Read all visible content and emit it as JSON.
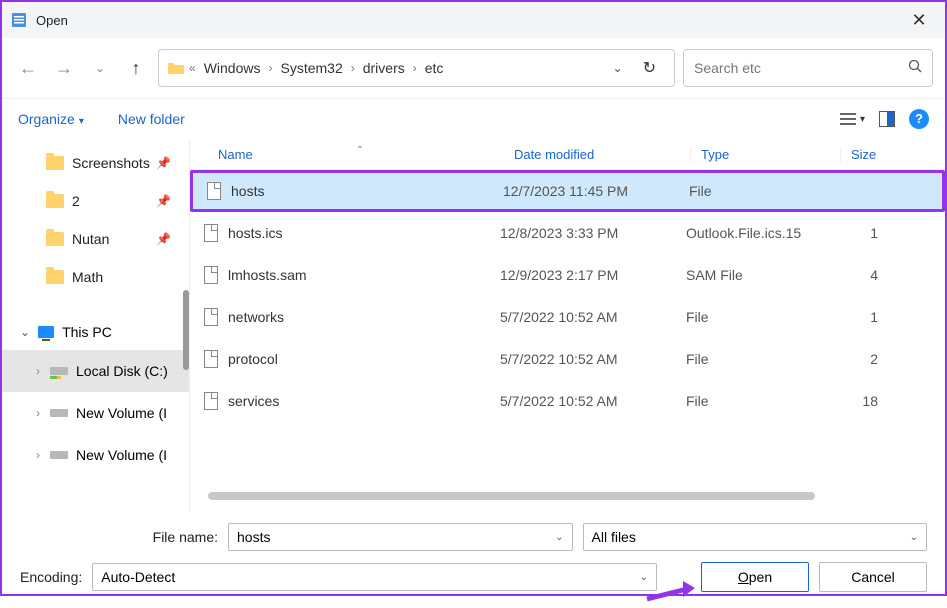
{
  "window": {
    "title": "Open"
  },
  "breadcrumbs": [
    "Windows",
    "System32",
    "drivers",
    "etc"
  ],
  "search": {
    "placeholder": "Search etc"
  },
  "toolbar": {
    "organize": "Organize",
    "new_folder": "New folder"
  },
  "sidebar": {
    "quick": [
      {
        "label": "Screenshots",
        "pinned": true
      },
      {
        "label": "2",
        "pinned": true
      },
      {
        "label": "Nutan",
        "pinned": true
      },
      {
        "label": "Math",
        "pinned": false
      }
    ],
    "this_pc": "This PC",
    "drives": [
      {
        "label": "Local Disk (C:)",
        "selected": true
      },
      {
        "label": "New Volume (I",
        "selected": false
      },
      {
        "label": "New Volume (I",
        "selected": false
      }
    ]
  },
  "columns": {
    "name": "Name",
    "date": "Date modified",
    "type": "Type",
    "size": "Size"
  },
  "files": [
    {
      "name": "hosts",
      "date": "12/7/2023 11:45 PM",
      "type": "File",
      "size": "",
      "highlighted": true
    },
    {
      "name": "hosts.ics",
      "date": "12/8/2023 3:33 PM",
      "type": "Outlook.File.ics.15",
      "size": "1"
    },
    {
      "name": "lmhosts.sam",
      "date": "12/9/2023 2:17 PM",
      "type": "SAM File",
      "size": "4"
    },
    {
      "name": "networks",
      "date": "5/7/2022 10:52 AM",
      "type": "File",
      "size": "1"
    },
    {
      "name": "protocol",
      "date": "5/7/2022 10:52 AM",
      "type": "File",
      "size": "2"
    },
    {
      "name": "services",
      "date": "5/7/2022 10:52 AM",
      "type": "File",
      "size": "18"
    }
  ],
  "footer": {
    "filename_label": "File name:",
    "filename_value": "hosts",
    "filter_value": "All files",
    "encoding_label": "Encoding:",
    "encoding_value": "Auto-Detect",
    "open": "pen",
    "open_u": "O",
    "cancel": "Cancel"
  }
}
